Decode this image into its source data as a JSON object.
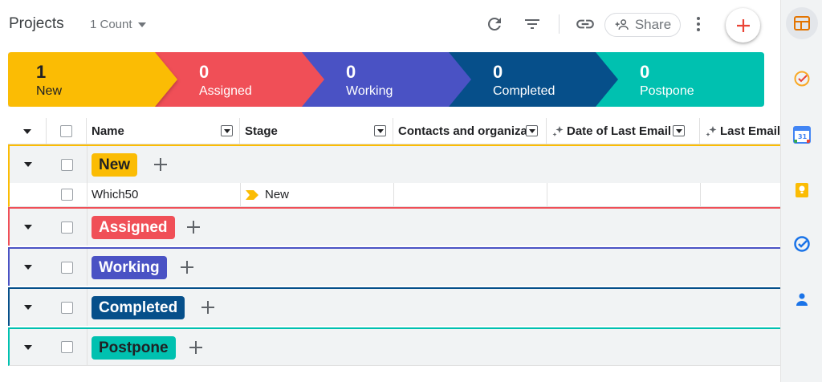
{
  "header": {
    "title": "Projects",
    "count_label": "1 Count",
    "share_label": "Share"
  },
  "pipeline": [
    {
      "count": "1",
      "name": "New",
      "color": "#fbbc04",
      "text_color": "#202124"
    },
    {
      "count": "0",
      "name": "Assigned",
      "color": "#f04f57",
      "text_color": "#ffffff"
    },
    {
      "count": "0",
      "name": "Working",
      "color": "#4a52c4",
      "text_color": "#ffffff"
    },
    {
      "count": "0",
      "name": "Completed",
      "color": "#064f8a",
      "text_color": "#ffffff"
    },
    {
      "count": "0",
      "name": "Postpone",
      "color": "#00c1b0",
      "text_color": "#ffffff"
    }
  ],
  "table": {
    "columns": [
      "Name",
      "Stage",
      "Contacts and organizations",
      "Date of Last Email",
      "Last Email"
    ],
    "groups": [
      {
        "label": "New",
        "chip_color": "#fbbc04",
        "chip_text": "#202124",
        "border": "#fbbc04"
      },
      {
        "label": "Assigned",
        "chip_color": "#f04f57",
        "chip_text": "#ffffff",
        "border": "#f04f57"
      },
      {
        "label": "Working",
        "chip_color": "#4a52c4",
        "chip_text": "#ffffff",
        "border": "#4a52c4"
      },
      {
        "label": "Completed",
        "chip_color": "#064f8a",
        "chip_text": "#ffffff",
        "border": "#064f8a"
      },
      {
        "label": "Postpone",
        "chip_color": "#00c1b0",
        "chip_text": "#202124",
        "border": "#00c1b0"
      }
    ],
    "rows": [
      {
        "name": "Which50",
        "stage": "New"
      }
    ]
  },
  "side_panel": [
    "calendar-layout-icon",
    "tasks-check-icon",
    "google-calendar-icon",
    "keep-bulb-icon",
    "tasks-icon",
    "contacts-icon"
  ],
  "colors": {
    "accent": "#ea4335",
    "border": "#e0e0e0"
  }
}
